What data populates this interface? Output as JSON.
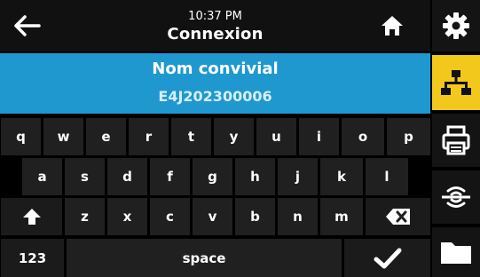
{
  "header": {
    "time": "10:37 PM",
    "title": "Connexion"
  },
  "field": {
    "label": "Nom convivial",
    "value": "E4J202300006"
  },
  "keyboard": {
    "row1": [
      "q",
      "w",
      "e",
      "r",
      "t",
      "y",
      "u",
      "i",
      "o",
      "p"
    ],
    "row2": [
      "a",
      "s",
      "d",
      "f",
      "g",
      "h",
      "j",
      "k",
      "l"
    ],
    "row3": [
      "z",
      "x",
      "c",
      "v",
      "b",
      "n",
      "m"
    ],
    "mode_label": "123",
    "space_label": "space"
  },
  "sidebar": {
    "items": [
      {
        "icon": "gear-icon",
        "active": false
      },
      {
        "icon": "network-icon",
        "active": true
      },
      {
        "icon": "printer-icon",
        "active": false
      },
      {
        "icon": "wireless-icon",
        "active": false
      },
      {
        "icon": "folder-icon",
        "active": false
      }
    ]
  },
  "colors": {
    "accent": "#1f98cf",
    "active_tab": "#f3c81c",
    "key_bg": "#202020"
  }
}
